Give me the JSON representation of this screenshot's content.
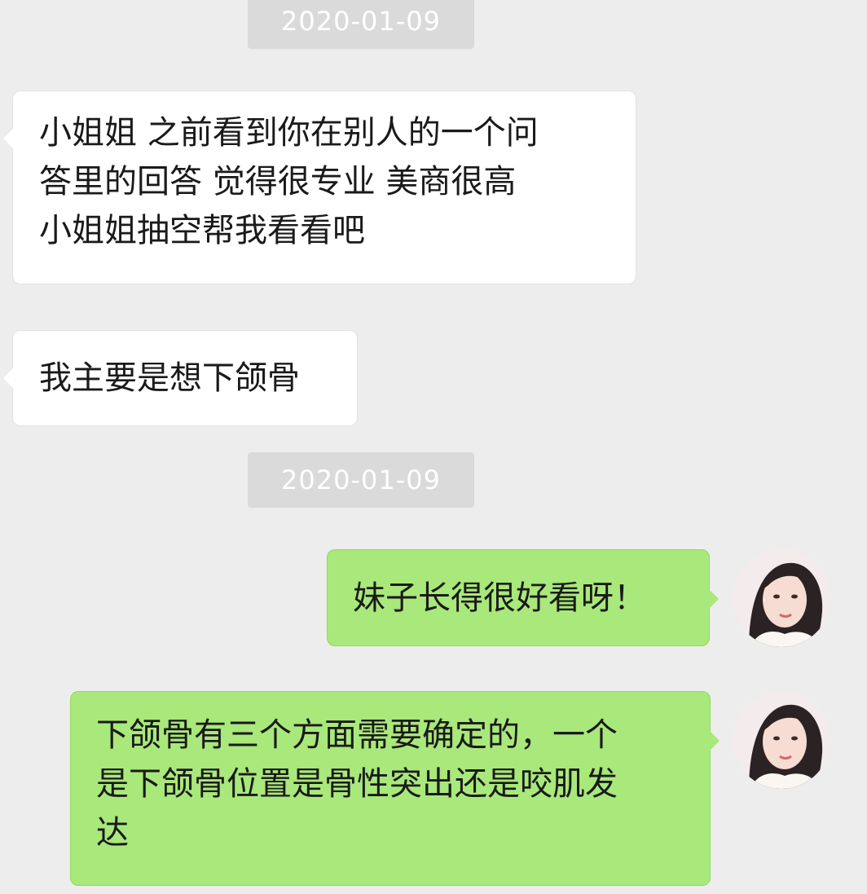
{
  "chat": {
    "timestamps": [
      "2020-01-09",
      "2020-01-09"
    ],
    "messages": [
      {
        "side": "incoming",
        "text": "小姐姐  之前看到你在别人的一个问\n答里的回答 觉得很专业  美商很高\n小姐姐抽空帮我看看吧"
      },
      {
        "side": "incoming",
        "text": "我主要是想下颌骨"
      },
      {
        "side": "outgoing",
        "text": "妹子长得很好看呀！"
      },
      {
        "side": "outgoing",
        "text": "下颌骨有三个方面需要确定的，一个\n是下颌骨位置是骨性突出还是咬肌发\n达"
      }
    ],
    "colors": {
      "background": "#ededed",
      "incoming_bubble": "#ffffff",
      "outgoing_bubble": "#a9e87a",
      "timestamp_bg": "#dadada"
    }
  }
}
